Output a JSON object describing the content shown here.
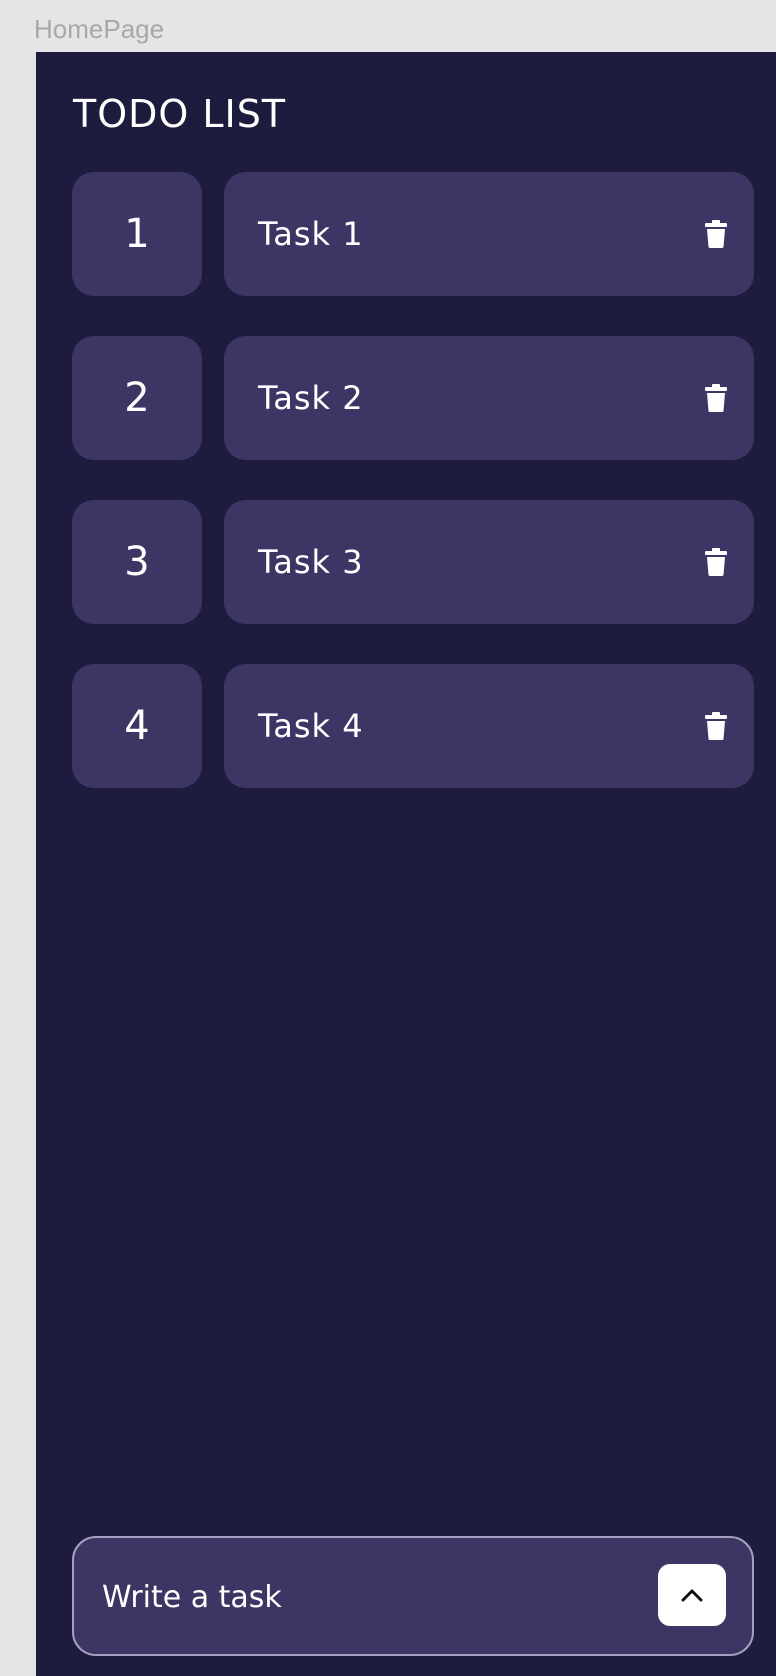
{
  "frame": {
    "label": "HomePage"
  },
  "header": {
    "title": "TODO LIST"
  },
  "tasks": [
    {
      "number": "1",
      "text": "Task 1",
      "action_icon": "trash-icon"
    },
    {
      "number": "2",
      "text": "Task 2",
      "action_icon": "trash-icon"
    },
    {
      "number": "3",
      "text": "Task 3",
      "action_icon": "trash-icon"
    },
    {
      "number": "4",
      "text": "Task 4",
      "action_icon": "trash-icon"
    }
  ],
  "composer": {
    "placeholder": "Write a task",
    "submit_icon": "chevron-up-icon"
  },
  "colors": {
    "background": "#1e1c3e",
    "card": "#3d3563",
    "text": "#ffffff",
    "outer": "#e5e5e5"
  }
}
